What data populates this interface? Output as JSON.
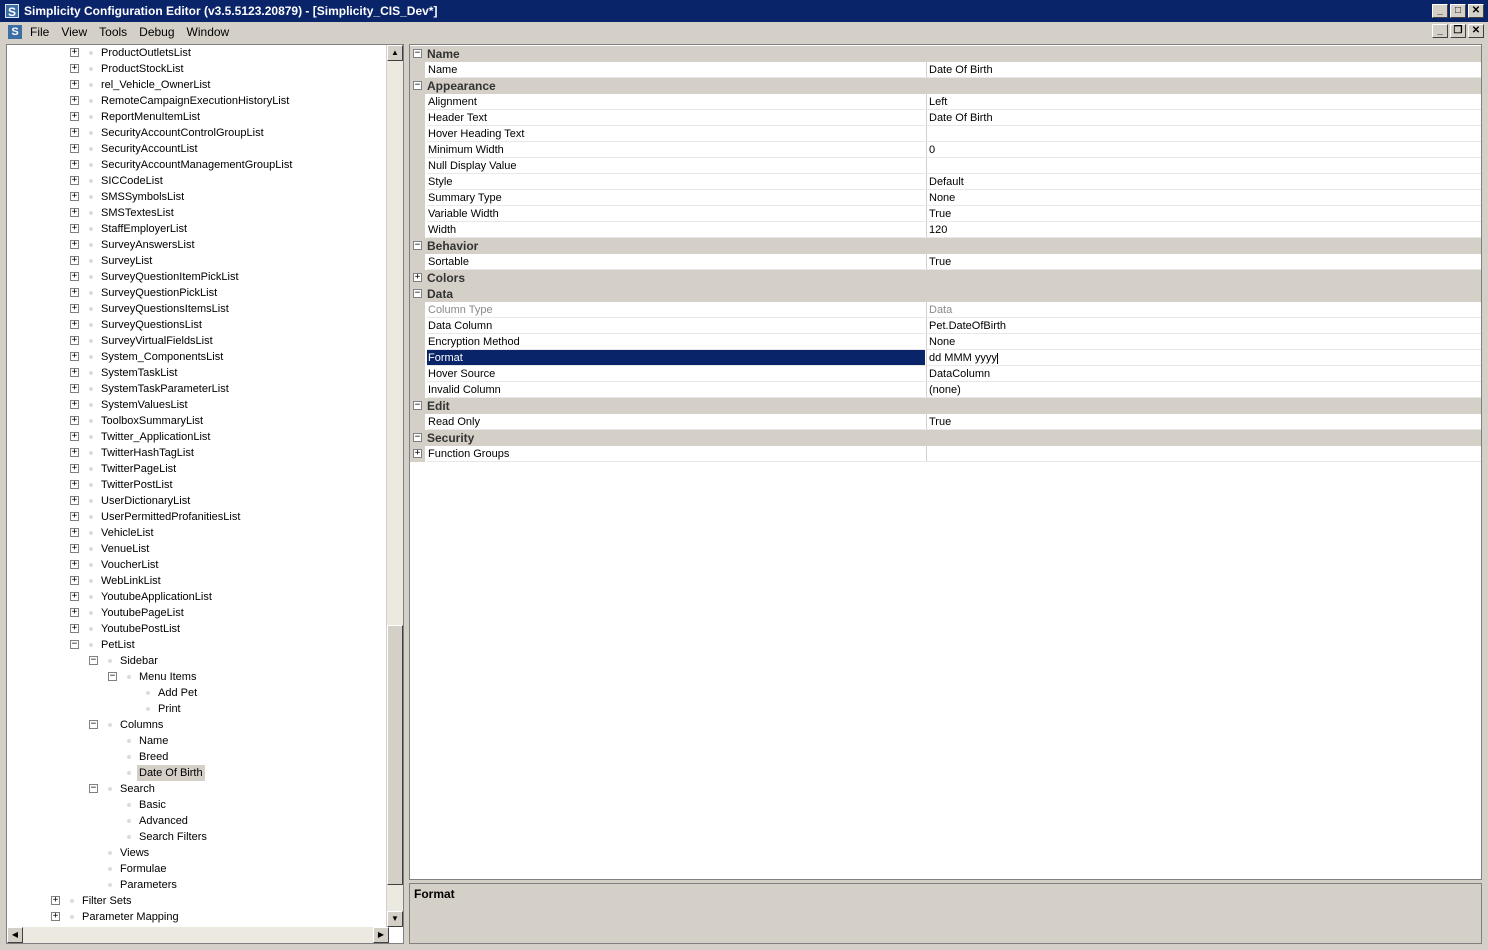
{
  "window": {
    "title": "Simplicity Configuration Editor (v3.5.5123.20879) - [Simplicity_CIS_Dev*]",
    "app_icon_letter": "S",
    "controls": [
      "minimize",
      "maximize",
      "close"
    ]
  },
  "menubar": {
    "items": [
      "File",
      "View",
      "Tools",
      "Debug",
      "Window"
    ]
  },
  "tree": {
    "items": [
      {
        "label": "ProductOutletsList",
        "level": 2,
        "expander": "+"
      },
      {
        "label": "ProductStockList",
        "level": 2,
        "expander": "+"
      },
      {
        "label": "rel_Vehicle_OwnerList",
        "level": 2,
        "expander": "+"
      },
      {
        "label": "RemoteCampaignExecutionHistoryList",
        "level": 2,
        "expander": "+"
      },
      {
        "label": "ReportMenuItemList",
        "level": 2,
        "expander": "+"
      },
      {
        "label": "SecurityAccountControlGroupList",
        "level": 2,
        "expander": "+"
      },
      {
        "label": "SecurityAccountList",
        "level": 2,
        "expander": "+"
      },
      {
        "label": "SecurityAccountManagementGroupList",
        "level": 2,
        "expander": "+"
      },
      {
        "label": "SICCodeList",
        "level": 2,
        "expander": "+"
      },
      {
        "label": "SMSSymbolsList",
        "level": 2,
        "expander": "+"
      },
      {
        "label": "SMSTextesList",
        "level": 2,
        "expander": "+"
      },
      {
        "label": "StaffEmployerList",
        "level": 2,
        "expander": "+"
      },
      {
        "label": "SurveyAnswersList",
        "level": 2,
        "expander": "+"
      },
      {
        "label": "SurveyList",
        "level": 2,
        "expander": "+"
      },
      {
        "label": "SurveyQuestionItemPickList",
        "level": 2,
        "expander": "+"
      },
      {
        "label": "SurveyQuestionPickList",
        "level": 2,
        "expander": "+"
      },
      {
        "label": "SurveyQuestionsItemsList",
        "level": 2,
        "expander": "+"
      },
      {
        "label": "SurveyQuestionsList",
        "level": 2,
        "expander": "+"
      },
      {
        "label": "SurveyVirtualFieldsList",
        "level": 2,
        "expander": "+"
      },
      {
        "label": "System_ComponentsList",
        "level": 2,
        "expander": "+"
      },
      {
        "label": "SystemTaskList",
        "level": 2,
        "expander": "+"
      },
      {
        "label": "SystemTaskParameterList",
        "level": 2,
        "expander": "+"
      },
      {
        "label": "SystemValuesList",
        "level": 2,
        "expander": "+"
      },
      {
        "label": "ToolboxSummaryList",
        "level": 2,
        "expander": "+"
      },
      {
        "label": "Twitter_ApplicationList",
        "level": 2,
        "expander": "+"
      },
      {
        "label": "TwitterHashTagList",
        "level": 2,
        "expander": "+"
      },
      {
        "label": "TwitterPageList",
        "level": 2,
        "expander": "+"
      },
      {
        "label": "TwitterPostList",
        "level": 2,
        "expander": "+"
      },
      {
        "label": "UserDictionaryList",
        "level": 2,
        "expander": "+"
      },
      {
        "label": "UserPermittedProfanitiesList",
        "level": 2,
        "expander": "+"
      },
      {
        "label": "VehicleList",
        "level": 2,
        "expander": "+"
      },
      {
        "label": "VenueList",
        "level": 2,
        "expander": "+"
      },
      {
        "label": "VoucherList",
        "level": 2,
        "expander": "+"
      },
      {
        "label": "WebLinkList",
        "level": 2,
        "expander": "+"
      },
      {
        "label": "YoutubeApplicationList",
        "level": 2,
        "expander": "+"
      },
      {
        "label": "YoutubePageList",
        "level": 2,
        "expander": "+"
      },
      {
        "label": "YoutubePostList",
        "level": 2,
        "expander": "+"
      },
      {
        "label": "PetList",
        "level": 2,
        "expander": "−"
      },
      {
        "label": "Sidebar",
        "level": 3,
        "expander": "−"
      },
      {
        "label": "Menu Items",
        "level": 4,
        "expander": "−"
      },
      {
        "label": "Add Pet",
        "level": 5,
        "expander": ""
      },
      {
        "label": "Print",
        "level": 5,
        "expander": ""
      },
      {
        "label": "Columns",
        "level": 3,
        "expander": "−"
      },
      {
        "label": "Name",
        "level": 4,
        "expander": ""
      },
      {
        "label": "Breed",
        "level": 4,
        "expander": ""
      },
      {
        "label": "Date Of Birth",
        "level": 4,
        "expander": "",
        "selected": true
      },
      {
        "label": "Search",
        "level": 3,
        "expander": "−"
      },
      {
        "label": "Basic",
        "level": 4,
        "expander": ""
      },
      {
        "label": "Advanced",
        "level": 4,
        "expander": ""
      },
      {
        "label": "Search Filters",
        "level": 4,
        "expander": ""
      },
      {
        "label": "Views",
        "level": 3,
        "expander": ""
      },
      {
        "label": "Formulae",
        "level": 3,
        "expander": ""
      },
      {
        "label": "Parameters",
        "level": 3,
        "expander": ""
      },
      {
        "label": "Filter Sets",
        "level": 1,
        "expander": "+"
      },
      {
        "label": "Parameter Mapping",
        "level": 1,
        "expander": "+"
      }
    ]
  },
  "properties": {
    "rows": [
      {
        "type": "category",
        "label": "Name",
        "expander": "−"
      },
      {
        "type": "prop",
        "name": "Name",
        "value": "Date Of Birth"
      },
      {
        "type": "category",
        "label": "Appearance",
        "expander": "−"
      },
      {
        "type": "prop",
        "name": "Alignment",
        "value": "Left"
      },
      {
        "type": "prop",
        "name": "Header Text",
        "value": "Date Of Birth"
      },
      {
        "type": "prop",
        "name": "Hover Heading Text",
        "value": ""
      },
      {
        "type": "prop",
        "name": "Minimum Width",
        "value": "0"
      },
      {
        "type": "prop",
        "name": "Null Display Value",
        "value": ""
      },
      {
        "type": "prop",
        "name": "Style",
        "value": "Default"
      },
      {
        "type": "prop",
        "name": "Summary Type",
        "value": "None"
      },
      {
        "type": "prop",
        "name": "Variable Width",
        "value": "True"
      },
      {
        "type": "prop",
        "name": "Width",
        "value": "120"
      },
      {
        "type": "category",
        "label": "Behavior",
        "expander": "−"
      },
      {
        "type": "prop",
        "name": "Sortable",
        "value": "True"
      },
      {
        "type": "category",
        "label": "Colors",
        "expander": "+"
      },
      {
        "type": "category",
        "label": "Data",
        "expander": "−"
      },
      {
        "type": "prop",
        "name": "Column Type",
        "value": "Data",
        "disabled": true
      },
      {
        "type": "prop",
        "name": "Data Column",
        "value": "Pet.DateOfBirth"
      },
      {
        "type": "prop",
        "name": "Encryption Method",
        "value": "None"
      },
      {
        "type": "prop",
        "name": "Format",
        "value": "dd MMM yyyy",
        "selected": true,
        "editing": true
      },
      {
        "type": "prop",
        "name": "Hover Source",
        "value": "DataColumn"
      },
      {
        "type": "prop",
        "name": "Invalid Column",
        "value": "(none)"
      },
      {
        "type": "category",
        "label": "Edit",
        "expander": "−"
      },
      {
        "type": "prop",
        "name": "Read Only",
        "value": "True"
      },
      {
        "type": "category",
        "label": "Security",
        "expander": "−"
      },
      {
        "type": "prop",
        "name": "Function Groups",
        "value": "",
        "expander": "+"
      }
    ]
  },
  "description": {
    "title": "Format"
  },
  "colors": {
    "titlebar": "#0a246a",
    "selection": "#0a246a",
    "chrome": "#d4d0c8"
  }
}
